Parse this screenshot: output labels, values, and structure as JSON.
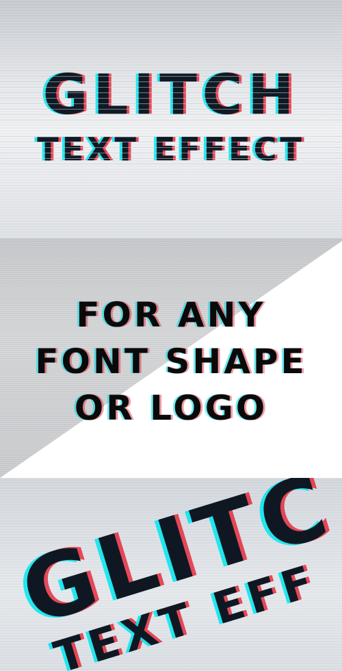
{
  "panel_1": {
    "title": "GLITCH",
    "subtitle": "TEXT EFFECT"
  },
  "panel_2": {
    "lines": [
      "FOR ANY",
      "FONT SHAPE",
      "OR LOGO"
    ]
  },
  "panel_3": {
    "title": "GLITC",
    "subtitle": "TEXT EFF"
  },
  "colors": {
    "text_dark": "#0f1822",
    "glitch_cyan": "#00e6f0",
    "glitch_red": "#e61428",
    "wedge_white": "#ffffff"
  }
}
